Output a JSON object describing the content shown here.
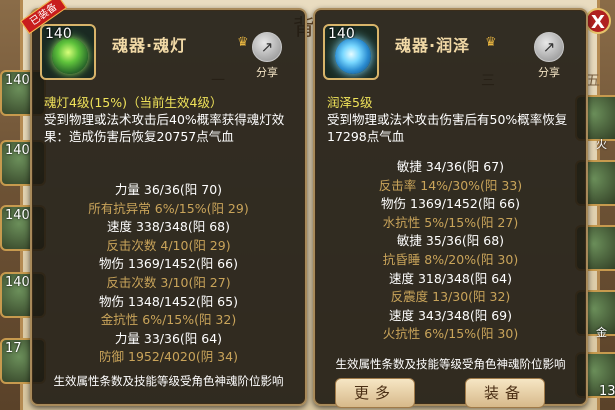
{
  "left": {
    "badge": "已装备",
    "level": "140",
    "title": "魂器·魂灯",
    "share_label": "分享",
    "desc_head": "魂灯4级(15%)（当前生效4级）",
    "desc_body": "受到物理或法术攻击后40%概率获得魂灯效果：造成伤害后恢复20757点气血",
    "stats": [
      {
        "text": "力量 36/36(阳 70)",
        "active": true
      },
      {
        "text": "所有抗异常 6%/15%(阳 29)",
        "active": false
      },
      {
        "text": "速度 338/348(阳 68)",
        "active": true
      },
      {
        "text": "反击次数 4/10(阳 29)",
        "active": false
      },
      {
        "text": "物伤 1369/1452(阳 66)",
        "active": true
      },
      {
        "text": "反击次数 3/10(阳 27)",
        "active": false
      },
      {
        "text": "物伤 1348/1452(阳 65)",
        "active": true
      },
      {
        "text": "金抗性 6%/15%(阳 32)",
        "active": false
      },
      {
        "text": "力量 33/36(阳 64)",
        "active": true
      },
      {
        "text": "防御 1952/4020(阴 34)",
        "active": false
      }
    ],
    "footer": "生效属性条数及技能等级受角色神魂阶位影响"
  },
  "right": {
    "level": "140",
    "title": "魂器·润泽",
    "share_label": "分享",
    "desc_head": "润泽5级",
    "desc_body": "受到物理或法术攻击伤害后有50%概率恢复17298点气血",
    "stats": [
      {
        "text": "敏捷 34/36(阳 67)",
        "active": true
      },
      {
        "text": "反击率 14%/30%(阳 33)",
        "active": false
      },
      {
        "text": "物伤 1369/1452(阳 66)",
        "active": true
      },
      {
        "text": "水抗性 5%/15%(阳 27)",
        "active": false
      },
      {
        "text": "敏捷 35/36(阳 68)",
        "active": true
      },
      {
        "text": "抗昏睡 8%/20%(阳 30)",
        "active": false
      },
      {
        "text": "速度 318/348(阳 64)",
        "active": true
      },
      {
        "text": "反震度 13/30(阳 32)",
        "active": false
      },
      {
        "text": "速度 343/348(阳 69)",
        "active": true
      },
      {
        "text": "火抗性 6%/15%(阳 30)",
        "active": false
      }
    ],
    "footer": "生效属性条数及技能等级受角色神魂阶位影响",
    "more_label": "更多",
    "equip_label": "装备"
  },
  "background": {
    "title": "背",
    "tab_1": "一",
    "tab_3": "三",
    "tab_5": "五",
    "slot_levels": [
      "140",
      "140",
      "140",
      "140",
      "17"
    ],
    "right_badge_1": "火",
    "right_badge_2": "金",
    "right_num": "13",
    "close": "X"
  },
  "colors": {
    "active_stat": "#ffffff",
    "inactive_stat": "#c9a45a",
    "effect_head": "#f0e35a"
  }
}
